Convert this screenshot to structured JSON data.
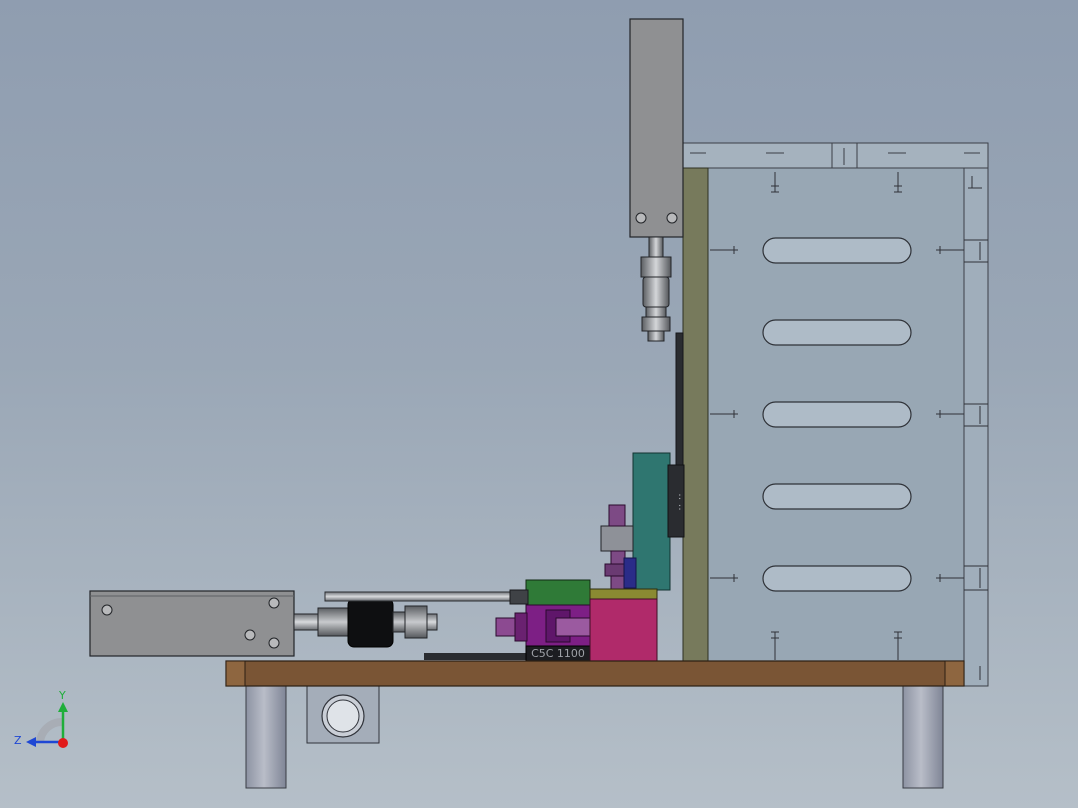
{
  "triad": {
    "y_label": "Y",
    "z_label": "Z"
  },
  "parts": {
    "cylinder_label": "C5C 1100"
  },
  "colors": {
    "background_top": "#8f9db0",
    "background_bottom": "#b5bfc8",
    "base_plate": "#7a5535",
    "magenta_block": "#b02a6a",
    "purple_part": "#7d1f85",
    "green_block": "#2f7a37",
    "teal_plate": "#2f7670",
    "olive_plate": "#777a5c",
    "frame_panel": "#98a7b4",
    "cylinder_gray": "#8f9092"
  }
}
